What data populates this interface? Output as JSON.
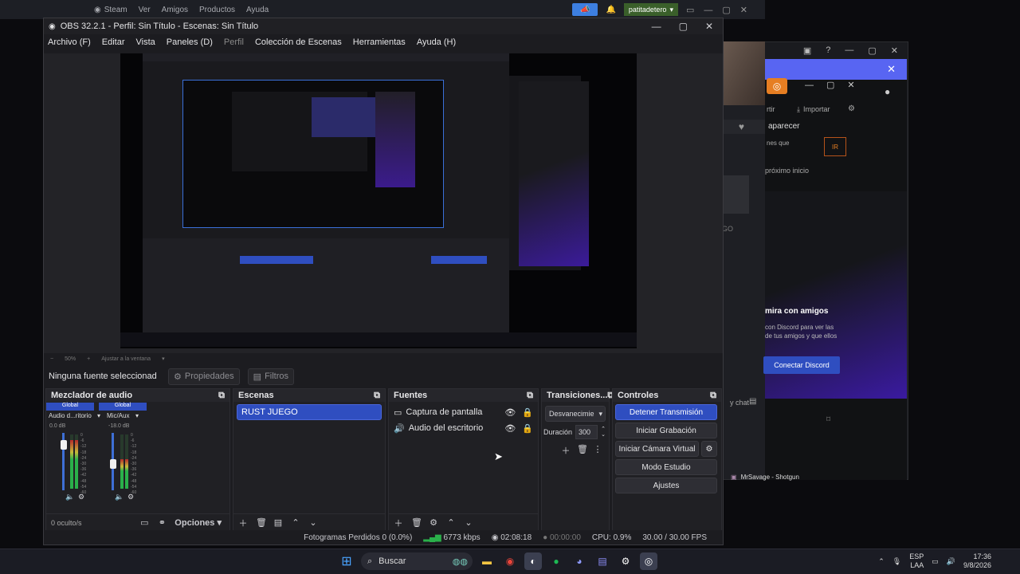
{
  "steam": {
    "menu": [
      "Steam",
      "Ver",
      "Amigos",
      "Productos",
      "Ayuda"
    ],
    "username": "patitadetero"
  },
  "obs": {
    "title": "OBS 32.2.1 - Perfil: Sin Título - Escenas: Sin Título",
    "menu": [
      "Archivo (F)",
      "Editar",
      "Vista",
      "Paneles (D)",
      "Perfil",
      "Colección de Escenas",
      "Herramientas",
      "Ayuda (H)"
    ],
    "zoom": "50%",
    "zoom_label": "Ajustar a la ventana",
    "no_source": "Ninguna fuente seleccionad",
    "properties_label": "Propiedades",
    "filters_label": "Filtros",
    "mixer": {
      "title": "Mezclador de audio",
      "channels": [
        {
          "header": "Global",
          "name": "Audio d...ritorio",
          "db": "0.0 dB",
          "level": 0.9
        },
        {
          "header": "Global",
          "name": "Mic/Aux",
          "db": "-18.0 dB",
          "level": 0.55
        }
      ],
      "scale": [
        "0",
        "-6",
        "-12",
        "-18",
        "-24",
        "-30",
        "-36",
        "-42",
        "-48",
        "-54",
        "-60"
      ],
      "footer_count": "0 oculto/s",
      "options_label": "Opciones"
    },
    "scenes": {
      "title": "Escenas",
      "items": [
        "RUST JUEGO"
      ]
    },
    "sources": {
      "title": "Fuentes",
      "items": [
        "Captura de pantalla",
        "Audio del escritorio"
      ]
    },
    "transitions": {
      "title": "Transiciones...",
      "selected": "Desvanecimie",
      "duration_label": "Duración",
      "duration_value": "300"
    },
    "controls": {
      "title": "Controles",
      "buttons": [
        "Detener Transmisión",
        "Iniciar Grabación",
        "Iniciar Cámara Virtual",
        "Modo Estudio",
        "Ajustes"
      ]
    },
    "status": {
      "dropped": "Fotogramas Perdidos 0 (0.0%)",
      "kbps": "6773 kbps",
      "stream_time": "02:08:18",
      "rec_time": "00:00:00",
      "cpu": "CPU: 0.9%",
      "fps": "30.00 / 30.00 FPS"
    }
  },
  "discord": {
    "appear": "aparecer",
    "nes": "nes que",
    "next": "próximo inicio",
    "ir": "IR",
    "import": "Importar",
    "export": "rtir",
    "friends": "mira con amigos",
    "friends_full": "mira con amigos",
    "desc": "con Discord para ver las\nde tus amigos y que ellos",
    "connect": "Conectar Discord",
    "chat": "y chat",
    "go": "GO",
    "video": "MrSavage - Shotgun"
  },
  "taskbar": {
    "search": "Buscar",
    "lang": "ESP",
    "region": "LAA",
    "time": "17:36",
    "date": "9/8/2026"
  }
}
